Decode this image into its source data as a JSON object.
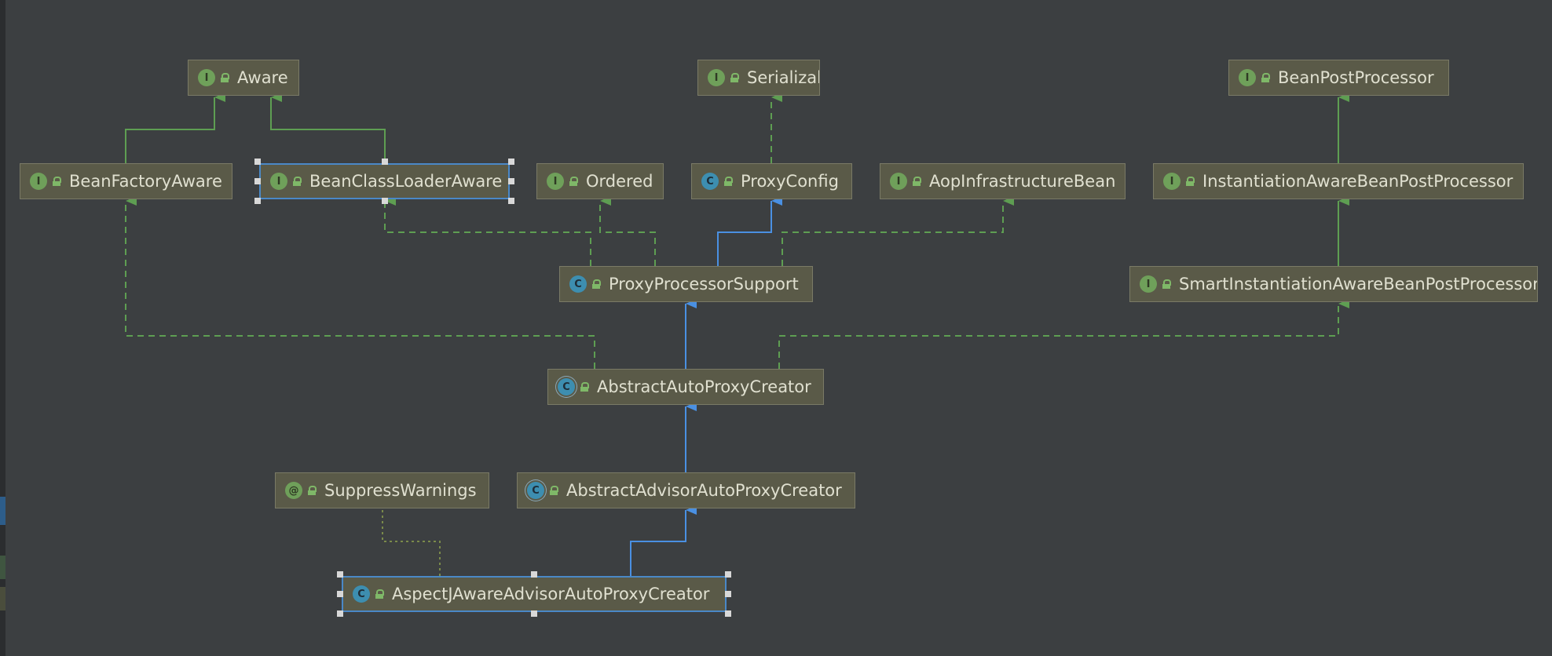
{
  "diagram": {
    "nodes": [
      {
        "id": "aware",
        "label": "Aware",
        "kind": "interface",
        "icon": "I"
      },
      {
        "id": "serializable",
        "label": "Serializable",
        "kind": "interface",
        "icon": "I"
      },
      {
        "id": "beanpostprocessor",
        "label": "BeanPostProcessor",
        "kind": "interface",
        "icon": "I"
      },
      {
        "id": "beanfactoryaware",
        "label": "BeanFactoryAware",
        "kind": "interface",
        "icon": "I"
      },
      {
        "id": "beanclassloaderaware",
        "label": "BeanClassLoaderAware",
        "kind": "interface",
        "icon": "I",
        "selected": true
      },
      {
        "id": "ordered",
        "label": "Ordered",
        "kind": "interface",
        "icon": "I"
      },
      {
        "id": "proxyconfig",
        "label": "ProxyConfig",
        "kind": "class",
        "icon": "C"
      },
      {
        "id": "aopinfrastructurebean",
        "label": "AopInfrastructureBean",
        "kind": "interface",
        "icon": "I"
      },
      {
        "id": "instantiationaware",
        "label": "InstantiationAwareBeanPostProcessor",
        "kind": "interface",
        "icon": "I"
      },
      {
        "id": "proxyprocessorsupport",
        "label": "ProxyProcessorSupport",
        "kind": "class",
        "icon": "C"
      },
      {
        "id": "smartinstantiationaware",
        "label": "SmartInstantiationAwareBeanPostProcessor",
        "kind": "interface",
        "icon": "I"
      },
      {
        "id": "abstractautoproxycreator",
        "label": "AbstractAutoProxyCreator",
        "kind": "abstract",
        "icon": "C"
      },
      {
        "id": "suppresswarnings",
        "label": "SuppressWarnings",
        "kind": "annotation",
        "icon": "@"
      },
      {
        "id": "abstractadvisorautoproxycreator",
        "label": "AbstractAdvisorAutoProxyCreator",
        "kind": "abstract",
        "icon": "C"
      },
      {
        "id": "aspectjaware",
        "label": "AspectJAwareAdvisorAutoProxyCreator",
        "kind": "class",
        "icon": "C",
        "selected": true
      }
    ],
    "edges": [
      {
        "from": "beanfactoryaware",
        "to": "aware",
        "type": "interface-extends"
      },
      {
        "from": "beanclassloaderaware",
        "to": "aware",
        "type": "interface-extends"
      },
      {
        "from": "proxyconfig",
        "to": "serializable",
        "type": "implements"
      },
      {
        "from": "instantiationaware",
        "to": "beanpostprocessor",
        "type": "interface-extends"
      },
      {
        "from": "smartinstantiationaware",
        "to": "instantiationaware",
        "type": "interface-extends"
      },
      {
        "from": "proxyprocessorsupport",
        "to": "beanclassloaderaware",
        "type": "implements"
      },
      {
        "from": "proxyprocessorsupport",
        "to": "ordered",
        "type": "implements"
      },
      {
        "from": "proxyprocessorsupport",
        "to": "proxyconfig",
        "type": "class-extends"
      },
      {
        "from": "proxyprocessorsupport",
        "to": "aopinfrastructurebean",
        "type": "implements"
      },
      {
        "from": "abstractautoproxycreator",
        "to": "proxyprocessorsupport",
        "type": "class-extends"
      },
      {
        "from": "abstractautoproxycreator",
        "to": "beanfactoryaware",
        "type": "implements"
      },
      {
        "from": "abstractautoproxycreator",
        "to": "smartinstantiationaware",
        "type": "implements"
      },
      {
        "from": "abstractadvisorautoproxycreator",
        "to": "abstractautoproxycreator",
        "type": "class-extends"
      },
      {
        "from": "aspectjaware",
        "to": "abstractadvisorautoproxycreator",
        "type": "class-extends"
      },
      {
        "from": "aspectjaware",
        "to": "suppresswarnings",
        "type": "annotated-by"
      }
    ]
  },
  "colors": {
    "background": "#3c3f41",
    "node_fill": "#5a5a48",
    "node_border": "#7a7a66",
    "text": "#e0e0d0",
    "interface_icon": "#6fa05a",
    "class_icon": "#3d8eb0",
    "class_extends_edge": "#4a90e2",
    "interface_edge": "#5e9e52",
    "annotation_edge": "#7a8a4a",
    "selection": "#4a88c7"
  }
}
